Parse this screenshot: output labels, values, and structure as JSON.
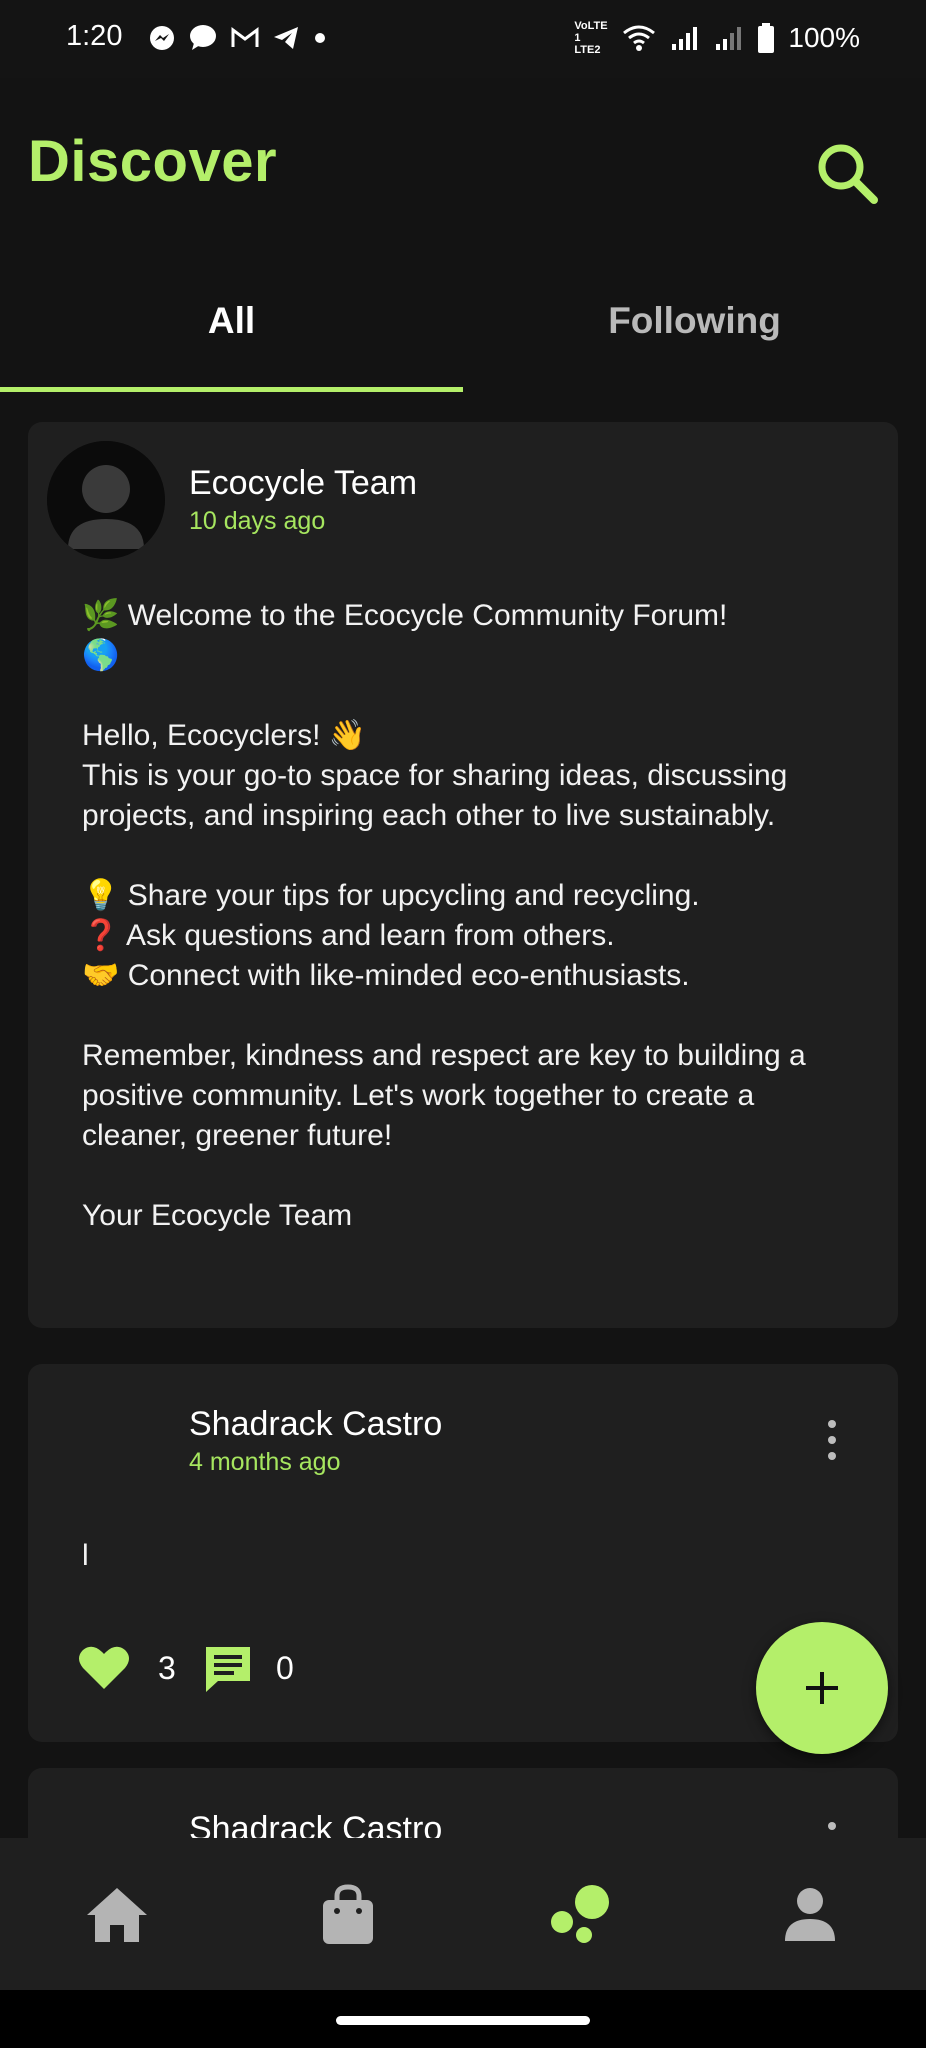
{
  "status_bar": {
    "time": "1:20",
    "battery": "100%",
    "network_label": "VoLTE 1 LTE2"
  },
  "header": {
    "title": "Discover"
  },
  "tabs": [
    {
      "label": "All",
      "selected": true
    },
    {
      "label": "Following",
      "selected": false
    }
  ],
  "posts": [
    {
      "author": "Ecocycle Team",
      "time": "10 days ago",
      "body": "🌿 Welcome to the Ecocycle Community Forum!\n🌎\n\nHello, Ecocyclers! 👋\nThis is your go-to space for sharing ideas, discussing projects, and inspiring each other to live sustainably.\n\n💡 Share your tips for upcycling and recycling.\n❓ Ask questions and learn from others.\n🤝 Connect with like-minded eco-enthusiasts.\n\nRemember, kindness and respect are key to building a positive community. Let's work together to create a cleaner, greener future!\n\nYour Ecocycle Team"
    },
    {
      "author": "Shadrack Castro",
      "time": "4 months ago",
      "body": "l",
      "likes": "3",
      "comments": "0"
    },
    {
      "author": "Shadrack Castro"
    }
  ],
  "fab": {
    "icon": "plus-icon",
    "label": "+"
  },
  "bottom_nav": [
    {
      "icon": "home-icon"
    },
    {
      "icon": "shopping-bag-icon"
    },
    {
      "icon": "community-bubbles-icon",
      "active": true
    },
    {
      "icon": "person-icon"
    }
  ],
  "colors": {
    "accent": "#b4ef6a",
    "background": "#131313",
    "card": "#1f1f1f",
    "inactive_icon": "#b4b4b4"
  }
}
